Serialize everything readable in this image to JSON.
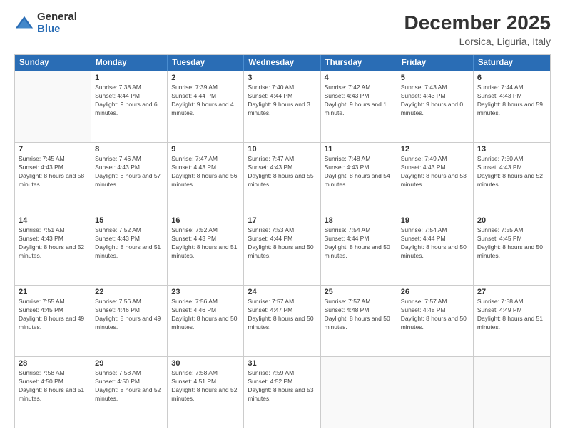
{
  "logo": {
    "general": "General",
    "blue": "Blue"
  },
  "header": {
    "title": "December 2025",
    "subtitle": "Lorsica, Liguria, Italy"
  },
  "weekdays": [
    "Sunday",
    "Monday",
    "Tuesday",
    "Wednesday",
    "Thursday",
    "Friday",
    "Saturday"
  ],
  "weeks": [
    [
      {
        "day": "",
        "sunrise": "",
        "sunset": "",
        "daylight": ""
      },
      {
        "day": "1",
        "sunrise": "Sunrise: 7:38 AM",
        "sunset": "Sunset: 4:44 PM",
        "daylight": "Daylight: 9 hours and 6 minutes."
      },
      {
        "day": "2",
        "sunrise": "Sunrise: 7:39 AM",
        "sunset": "Sunset: 4:44 PM",
        "daylight": "Daylight: 9 hours and 4 minutes."
      },
      {
        "day": "3",
        "sunrise": "Sunrise: 7:40 AM",
        "sunset": "Sunset: 4:44 PM",
        "daylight": "Daylight: 9 hours and 3 minutes."
      },
      {
        "day": "4",
        "sunrise": "Sunrise: 7:42 AM",
        "sunset": "Sunset: 4:43 PM",
        "daylight": "Daylight: 9 hours and 1 minute."
      },
      {
        "day": "5",
        "sunrise": "Sunrise: 7:43 AM",
        "sunset": "Sunset: 4:43 PM",
        "daylight": "Daylight: 9 hours and 0 minutes."
      },
      {
        "day": "6",
        "sunrise": "Sunrise: 7:44 AM",
        "sunset": "Sunset: 4:43 PM",
        "daylight": "Daylight: 8 hours and 59 minutes."
      }
    ],
    [
      {
        "day": "7",
        "sunrise": "Sunrise: 7:45 AM",
        "sunset": "Sunset: 4:43 PM",
        "daylight": "Daylight: 8 hours and 58 minutes."
      },
      {
        "day": "8",
        "sunrise": "Sunrise: 7:46 AM",
        "sunset": "Sunset: 4:43 PM",
        "daylight": "Daylight: 8 hours and 57 minutes."
      },
      {
        "day": "9",
        "sunrise": "Sunrise: 7:47 AM",
        "sunset": "Sunset: 4:43 PM",
        "daylight": "Daylight: 8 hours and 56 minutes."
      },
      {
        "day": "10",
        "sunrise": "Sunrise: 7:47 AM",
        "sunset": "Sunset: 4:43 PM",
        "daylight": "Daylight: 8 hours and 55 minutes."
      },
      {
        "day": "11",
        "sunrise": "Sunrise: 7:48 AM",
        "sunset": "Sunset: 4:43 PM",
        "daylight": "Daylight: 8 hours and 54 minutes."
      },
      {
        "day": "12",
        "sunrise": "Sunrise: 7:49 AM",
        "sunset": "Sunset: 4:43 PM",
        "daylight": "Daylight: 8 hours and 53 minutes."
      },
      {
        "day": "13",
        "sunrise": "Sunrise: 7:50 AM",
        "sunset": "Sunset: 4:43 PM",
        "daylight": "Daylight: 8 hours and 52 minutes."
      }
    ],
    [
      {
        "day": "14",
        "sunrise": "Sunrise: 7:51 AM",
        "sunset": "Sunset: 4:43 PM",
        "daylight": "Daylight: 8 hours and 52 minutes."
      },
      {
        "day": "15",
        "sunrise": "Sunrise: 7:52 AM",
        "sunset": "Sunset: 4:43 PM",
        "daylight": "Daylight: 8 hours and 51 minutes."
      },
      {
        "day": "16",
        "sunrise": "Sunrise: 7:52 AM",
        "sunset": "Sunset: 4:43 PM",
        "daylight": "Daylight: 8 hours and 51 minutes."
      },
      {
        "day": "17",
        "sunrise": "Sunrise: 7:53 AM",
        "sunset": "Sunset: 4:44 PM",
        "daylight": "Daylight: 8 hours and 50 minutes."
      },
      {
        "day": "18",
        "sunrise": "Sunrise: 7:54 AM",
        "sunset": "Sunset: 4:44 PM",
        "daylight": "Daylight: 8 hours and 50 minutes."
      },
      {
        "day": "19",
        "sunrise": "Sunrise: 7:54 AM",
        "sunset": "Sunset: 4:44 PM",
        "daylight": "Daylight: 8 hours and 50 minutes."
      },
      {
        "day": "20",
        "sunrise": "Sunrise: 7:55 AM",
        "sunset": "Sunset: 4:45 PM",
        "daylight": "Daylight: 8 hours and 50 minutes."
      }
    ],
    [
      {
        "day": "21",
        "sunrise": "Sunrise: 7:55 AM",
        "sunset": "Sunset: 4:45 PM",
        "daylight": "Daylight: 8 hours and 49 minutes."
      },
      {
        "day": "22",
        "sunrise": "Sunrise: 7:56 AM",
        "sunset": "Sunset: 4:46 PM",
        "daylight": "Daylight: 8 hours and 49 minutes."
      },
      {
        "day": "23",
        "sunrise": "Sunrise: 7:56 AM",
        "sunset": "Sunset: 4:46 PM",
        "daylight": "Daylight: 8 hours and 50 minutes."
      },
      {
        "day": "24",
        "sunrise": "Sunrise: 7:57 AM",
        "sunset": "Sunset: 4:47 PM",
        "daylight": "Daylight: 8 hours and 50 minutes."
      },
      {
        "day": "25",
        "sunrise": "Sunrise: 7:57 AM",
        "sunset": "Sunset: 4:48 PM",
        "daylight": "Daylight: 8 hours and 50 minutes."
      },
      {
        "day": "26",
        "sunrise": "Sunrise: 7:57 AM",
        "sunset": "Sunset: 4:48 PM",
        "daylight": "Daylight: 8 hours and 50 minutes."
      },
      {
        "day": "27",
        "sunrise": "Sunrise: 7:58 AM",
        "sunset": "Sunset: 4:49 PM",
        "daylight": "Daylight: 8 hours and 51 minutes."
      }
    ],
    [
      {
        "day": "28",
        "sunrise": "Sunrise: 7:58 AM",
        "sunset": "Sunset: 4:50 PM",
        "daylight": "Daylight: 8 hours and 51 minutes."
      },
      {
        "day": "29",
        "sunrise": "Sunrise: 7:58 AM",
        "sunset": "Sunset: 4:50 PM",
        "daylight": "Daylight: 8 hours and 52 minutes."
      },
      {
        "day": "30",
        "sunrise": "Sunrise: 7:58 AM",
        "sunset": "Sunset: 4:51 PM",
        "daylight": "Daylight: 8 hours and 52 minutes."
      },
      {
        "day": "31",
        "sunrise": "Sunrise: 7:59 AM",
        "sunset": "Sunset: 4:52 PM",
        "daylight": "Daylight: 8 hours and 53 minutes."
      },
      {
        "day": "",
        "sunrise": "",
        "sunset": "",
        "daylight": ""
      },
      {
        "day": "",
        "sunrise": "",
        "sunset": "",
        "daylight": ""
      },
      {
        "day": "",
        "sunrise": "",
        "sunset": "",
        "daylight": ""
      }
    ]
  ]
}
